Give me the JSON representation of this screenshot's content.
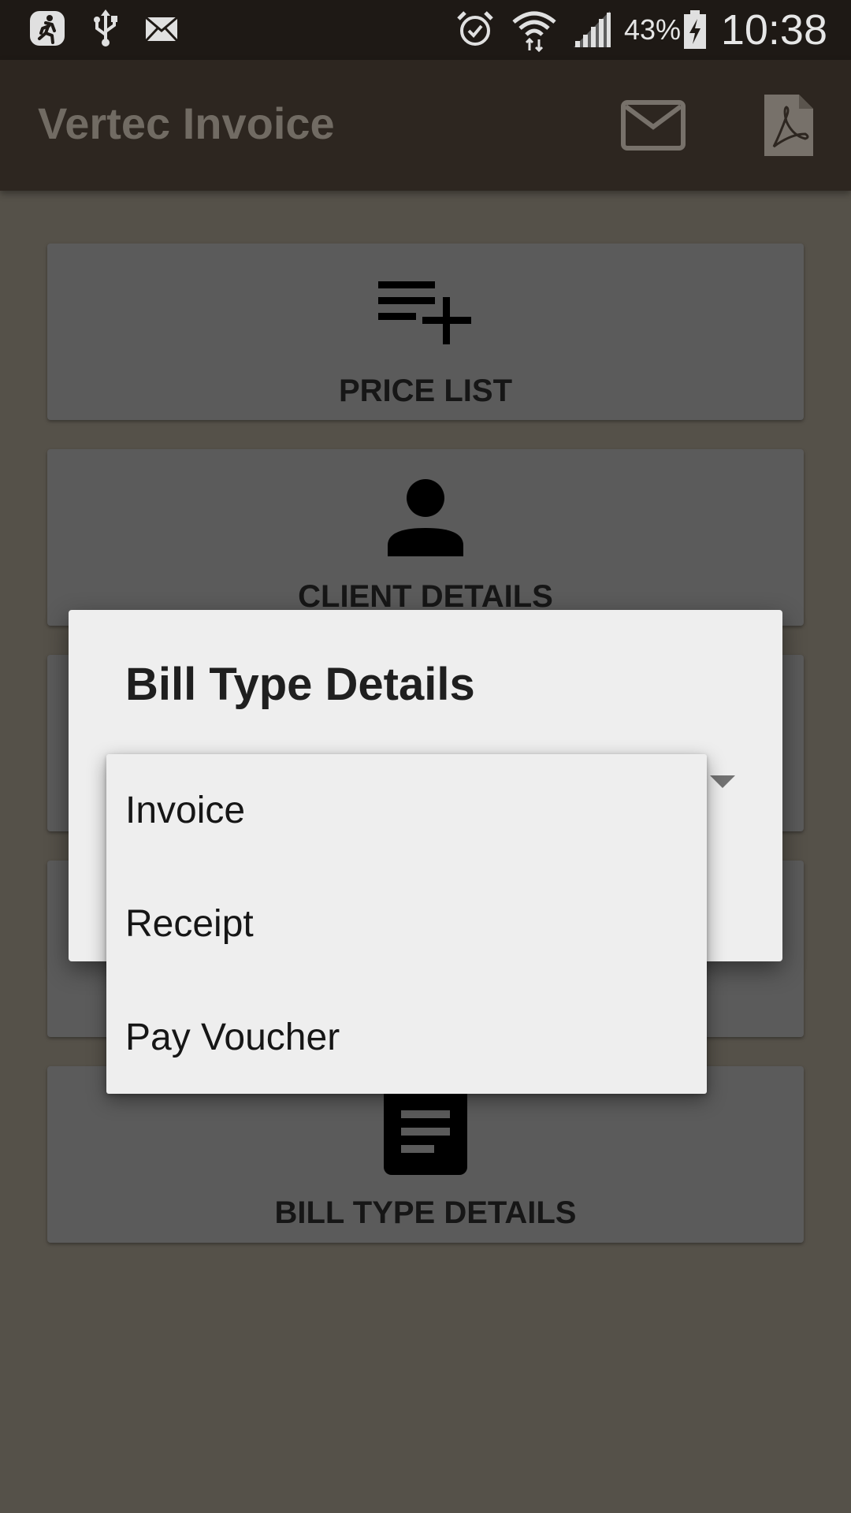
{
  "status_bar": {
    "battery_percent": "43%",
    "time": "10:38",
    "icons": [
      "runner-app-icon",
      "usb-icon",
      "mail-notification-icon",
      "alarm-icon",
      "wifi-icon",
      "signal-icon",
      "battery-charging-icon"
    ]
  },
  "app_bar": {
    "title": "Vertec Invoice",
    "actions": [
      "email-icon",
      "pdf-icon"
    ]
  },
  "cards": [
    {
      "label": "PRICE LIST",
      "icon": "playlist-add-icon"
    },
    {
      "label": "CLIENT DETAILS",
      "icon": "person-icon"
    },
    {
      "label": "BILL TYPE DETAILS",
      "icon": "document-icon"
    }
  ],
  "dialog": {
    "title": "Bill Type Details"
  },
  "dropdown": {
    "options": [
      "Invoice",
      "Receipt",
      "Pay Voucher"
    ]
  },
  "colors": {
    "status_bar": "#1e1915",
    "app_bar": "#2d2620",
    "background_scrim": "#555149",
    "card": "#5b5b5b",
    "dialog": "#eeeeee"
  }
}
